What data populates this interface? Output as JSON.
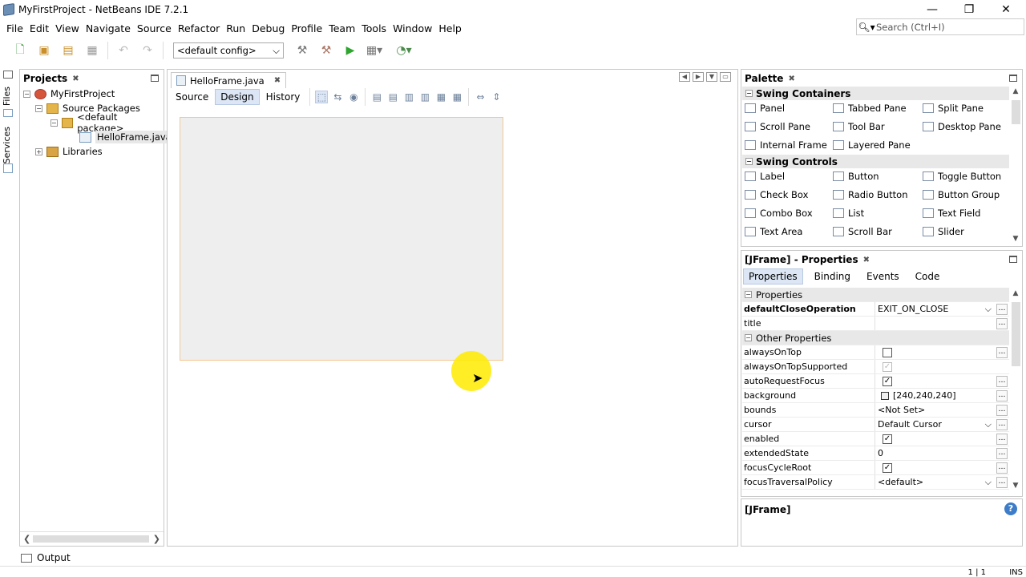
{
  "window": {
    "title": "MyFirstProject - NetBeans IDE 7.2.1",
    "min": "—",
    "max": "❐",
    "close": "✕"
  },
  "menu": [
    "File",
    "Edit",
    "View",
    "Navigate",
    "Source",
    "Refactor",
    "Run",
    "Debug",
    "Profile",
    "Team",
    "Tools",
    "Window",
    "Help"
  ],
  "search": {
    "placeholder": "Search (Ctrl+I)",
    "icon": "magnifier-icon"
  },
  "toolbar": {
    "config": "<default config>"
  },
  "sidetabs": {
    "files": "Files",
    "services": "Services"
  },
  "projects": {
    "title": "Projects",
    "tree": [
      {
        "label": "MyFirstProject",
        "level": 0,
        "icon": "project-icon",
        "toggle": "−"
      },
      {
        "label": "Source Packages",
        "level": 1,
        "icon": "package-folder-icon",
        "toggle": "−"
      },
      {
        "label": "<default package>",
        "level": 2,
        "icon": "package-icon",
        "toggle": "−"
      },
      {
        "label": "HelloFrame.java",
        "level": 3,
        "icon": "java-file-icon",
        "toggle": ""
      },
      {
        "label": "Libraries",
        "level": 1,
        "icon": "library-icon",
        "toggle": "+"
      }
    ]
  },
  "editor": {
    "tab": "HelloFrame.java",
    "views": [
      "Source",
      "Design",
      "History"
    ],
    "active_view": "Design"
  },
  "palette": {
    "title": "Palette",
    "categories": [
      {
        "name": "Swing Containers",
        "items": [
          "Panel",
          "Tabbed Pane",
          "Split Pane",
          "Scroll Pane",
          "Tool Bar",
          "Desktop Pane",
          "Internal Frame",
          "Layered Pane"
        ]
      },
      {
        "name": "Swing Controls",
        "items": [
          "Label",
          "Button",
          "Toggle Button",
          "Check Box",
          "Radio Button",
          "Button Group",
          "Combo Box",
          "List",
          "Text Field",
          "Text Area",
          "Scroll Bar",
          "Slider"
        ]
      }
    ]
  },
  "properties": {
    "title": "[JFrame] - Properties",
    "tabs": [
      "Properties",
      "Binding",
      "Events",
      "Code"
    ],
    "section1": "Properties",
    "section2": "Other Properties",
    "rows": {
      "defaultCloseOperation": {
        "name": "defaultCloseOperation",
        "value": "EXIT_ON_CLOSE"
      },
      "title": {
        "name": "title",
        "value": ""
      },
      "alwaysOnTop": {
        "name": "alwaysOnTop"
      },
      "alwaysOnTopSupported": {
        "name": "alwaysOnTopSupported"
      },
      "autoRequestFocus": {
        "name": "autoRequestFocus"
      },
      "background": {
        "name": "background",
        "value": "[240,240,240]"
      },
      "bounds": {
        "name": "bounds",
        "value": "<Not Set>"
      },
      "cursor": {
        "name": "cursor",
        "value": "Default Cursor"
      },
      "enabled": {
        "name": "enabled"
      },
      "extendedState": {
        "name": "extendedState",
        "value": "0"
      },
      "focusCycleRoot": {
        "name": "focusCycleRoot"
      },
      "focusTraversalPolicy": {
        "name": "focusTraversalPolicy",
        "value": "<default>"
      }
    }
  },
  "description": {
    "title": "[JFrame]"
  },
  "output": {
    "label": "Output"
  },
  "status": {
    "position": "1 | 1",
    "mode": "INS"
  },
  "colors": {
    "accent": "#dce6f4",
    "form_border": "#f4c890",
    "cursor_highlight": "#ffeb00"
  }
}
